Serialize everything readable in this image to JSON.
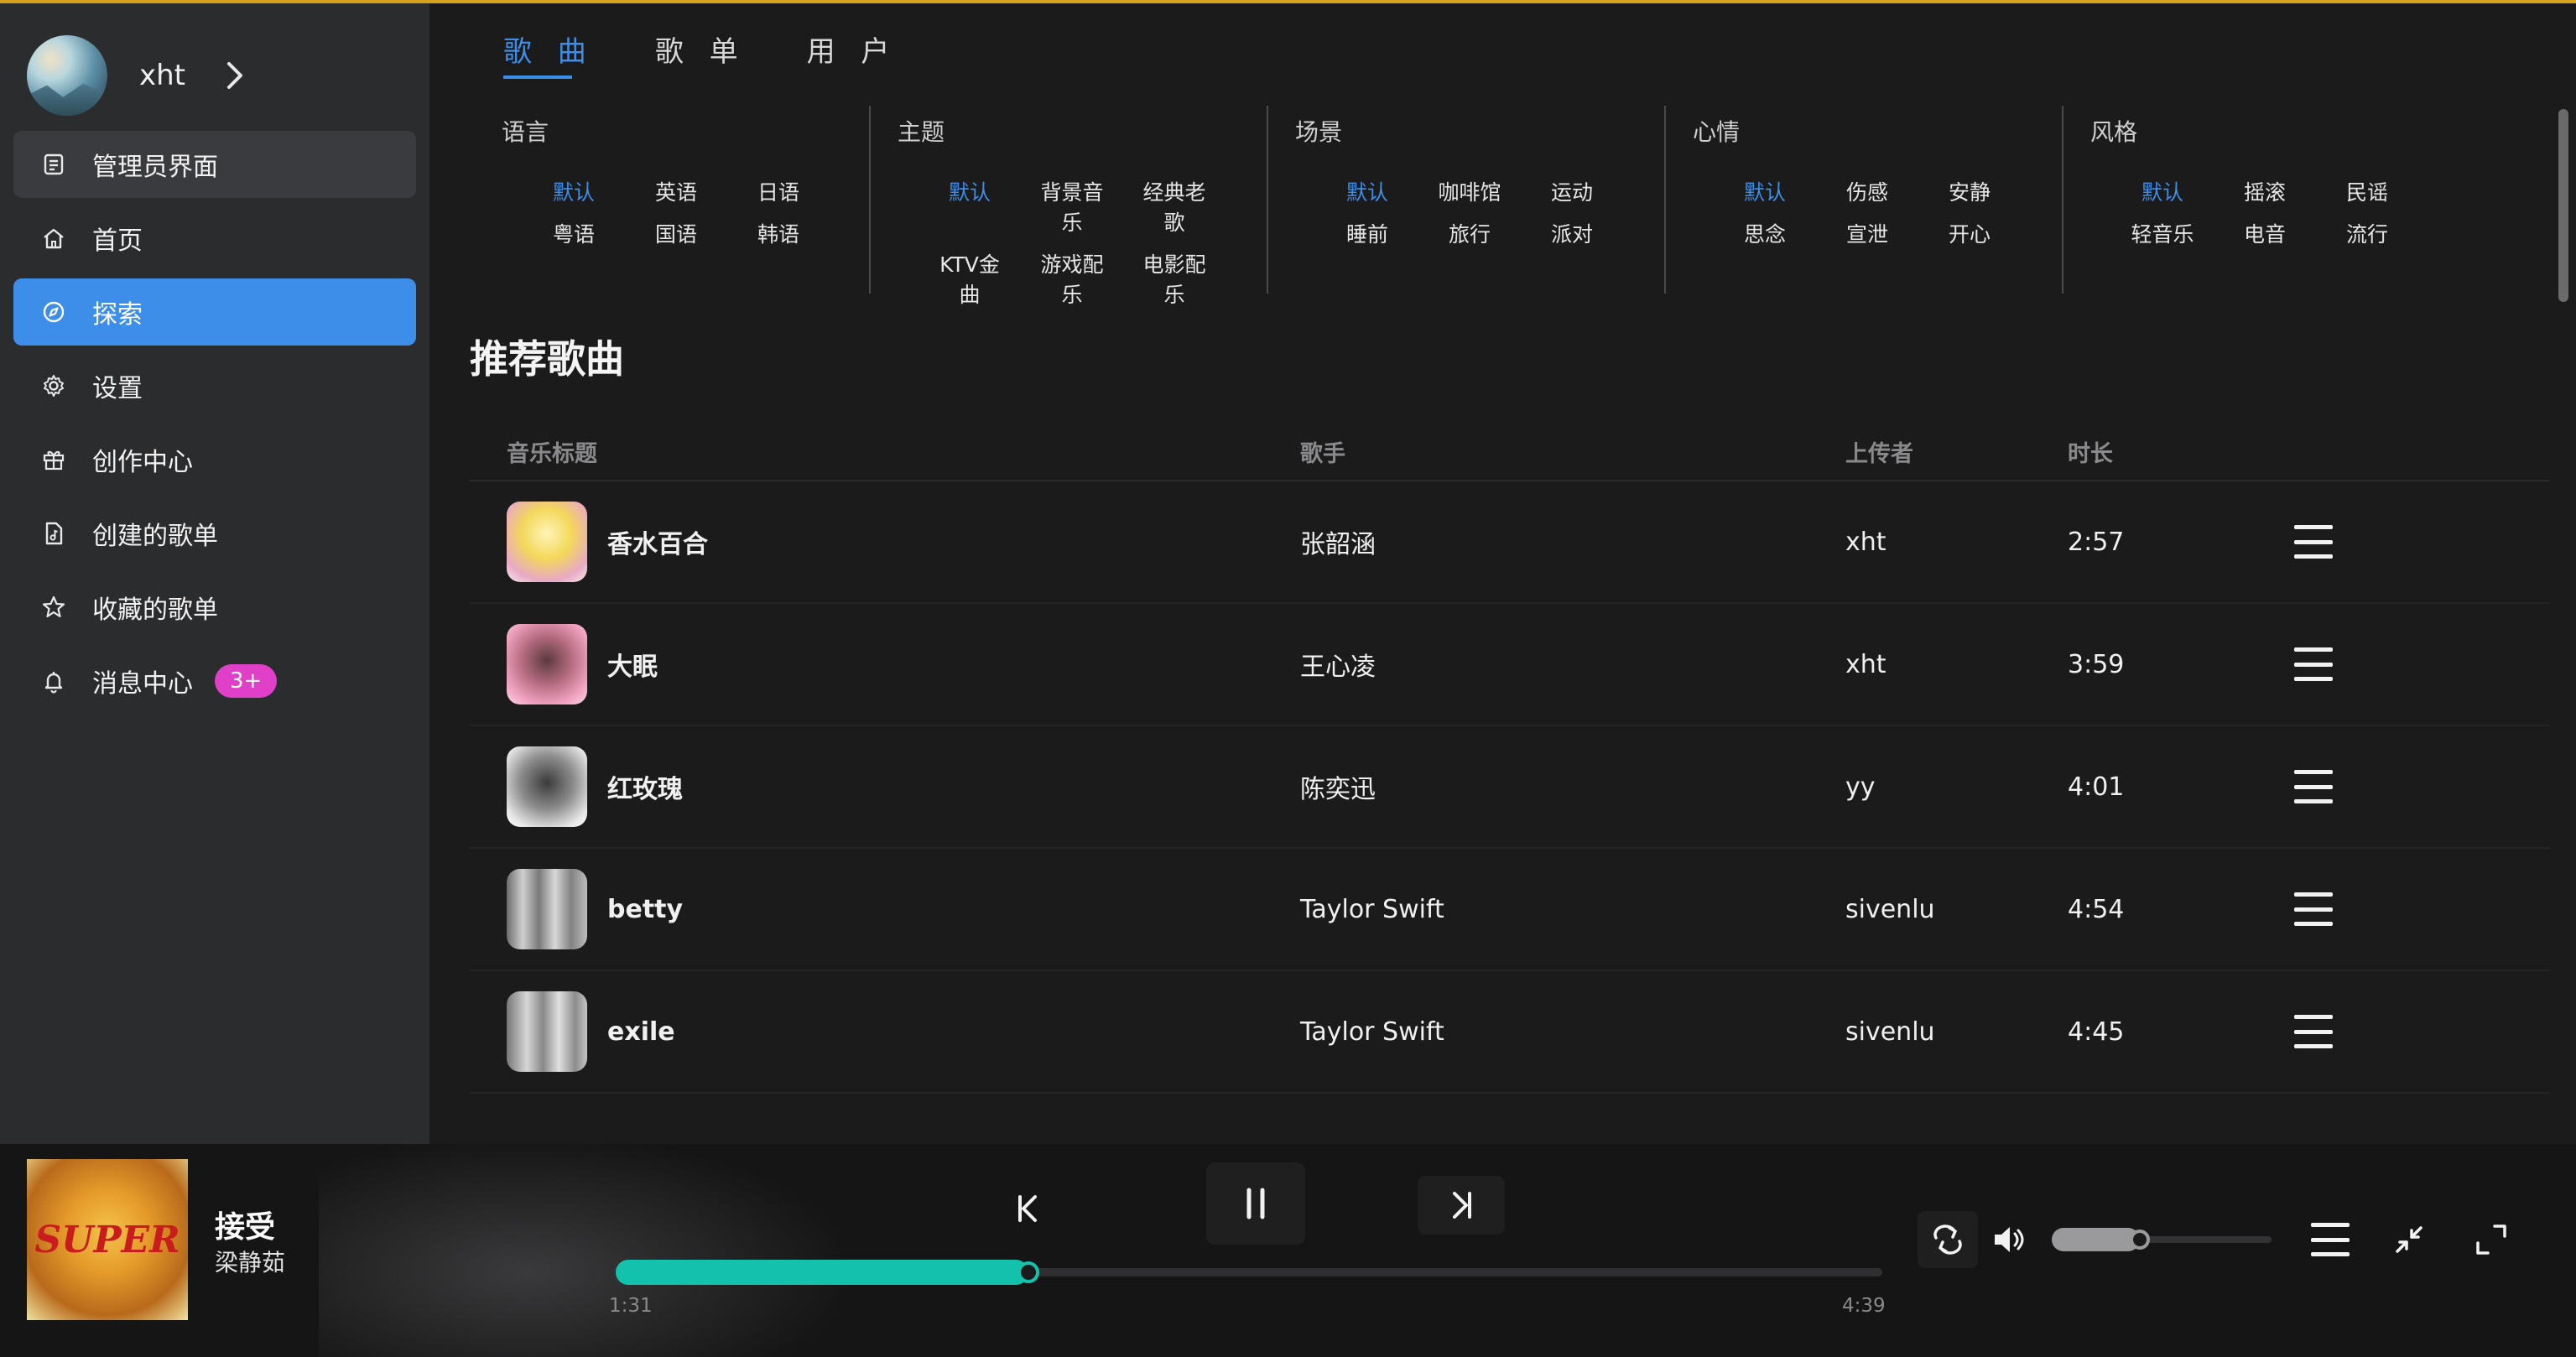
{
  "user": {
    "name": "xht"
  },
  "sidebar": {
    "items": [
      {
        "label": "管理员界面",
        "icon": "admin-icon",
        "state": "hover"
      },
      {
        "label": "首页",
        "icon": "home-icon",
        "state": ""
      },
      {
        "label": "探索",
        "icon": "compass-icon",
        "state": "active"
      },
      {
        "label": "设置",
        "icon": "gear-icon",
        "state": ""
      },
      {
        "label": "创作中心",
        "icon": "gift-icon",
        "state": ""
      },
      {
        "label": "创建的歌单",
        "icon": "music-file-icon",
        "state": ""
      },
      {
        "label": "收藏的歌单",
        "icon": "star-icon",
        "state": ""
      },
      {
        "label": "消息中心",
        "icon": "bell-icon",
        "state": "",
        "badge": "3+"
      }
    ]
  },
  "tabs": [
    "歌 曲",
    "歌 单",
    "用 户"
  ],
  "filters": [
    {
      "title": "语言",
      "options": [
        "默认",
        "英语",
        "日语",
        "粤语",
        "国语",
        "韩语"
      ]
    },
    {
      "title": "主题",
      "options": [
        "默认",
        "背景音乐",
        "经典老歌",
        "KTV金曲",
        "游戏配乐",
        "电影配乐"
      ]
    },
    {
      "title": "场景",
      "options": [
        "默认",
        "咖啡馆",
        "运动",
        "睡前",
        "旅行",
        "派对"
      ]
    },
    {
      "title": "心情",
      "options": [
        "默认",
        "伤感",
        "安静",
        "思念",
        "宣泄",
        "开心"
      ]
    },
    {
      "title": "风格",
      "options": [
        "默认",
        "摇滚",
        "民谣",
        "轻音乐",
        "电音",
        "流行"
      ]
    }
  ],
  "section_title": "推荐歌曲",
  "table": {
    "headers": {
      "title": "音乐标题",
      "artist": "歌手",
      "uploader": "上传者",
      "duration": "时长"
    },
    "rows": [
      {
        "title": "香水百合",
        "artist": "张韶涵",
        "uploader": "xht",
        "duration": "2:57"
      },
      {
        "title": "大眠",
        "artist": "王心凌",
        "uploader": "xht",
        "duration": "3:59"
      },
      {
        "title": "红玫瑰",
        "artist": "陈奕迅",
        "uploader": "yy",
        "duration": "4:01"
      },
      {
        "title": "betty",
        "artist": "Taylor Swift",
        "uploader": "sivenlu",
        "duration": "4:54"
      },
      {
        "title": "exile",
        "artist": "Taylor Swift",
        "uploader": "sivenlu",
        "duration": "4:45"
      }
    ]
  },
  "player": {
    "title": "接受",
    "artist": "梁静茹",
    "cover_text": "SUPER",
    "current_time": "1:31",
    "total_time": "4:39",
    "progress_fraction": 0.326,
    "volume_fraction": 0.4
  },
  "colors": {
    "accent": "#3d8ee8",
    "progress": "#12c2ad",
    "badge": "#e040c8",
    "topline": "#d6a21e"
  }
}
